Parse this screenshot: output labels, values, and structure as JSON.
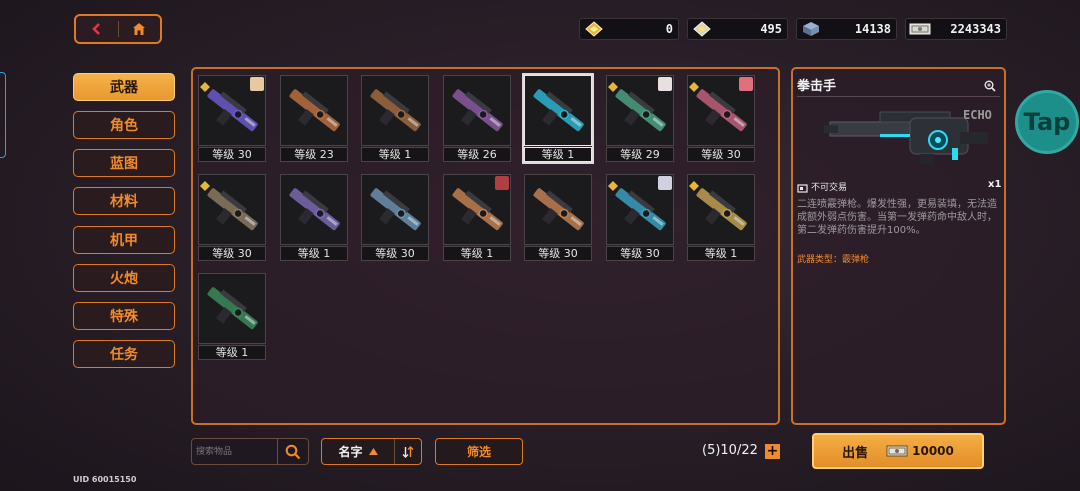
{
  "nav": {
    "back_icon": "back-arrow-icon",
    "home_icon": "home-icon"
  },
  "currencies": [
    {
      "icon": "gold-chip-icon",
      "value": "0"
    },
    {
      "icon": "silver-chip-icon",
      "value": "495"
    },
    {
      "icon": "cube-icon",
      "value": "14138"
    },
    {
      "icon": "cash-icon",
      "value": "2243343"
    }
  ],
  "categories": [
    "武器",
    "角色",
    "蓝图",
    "材料",
    "机甲",
    "火炮",
    "特殊",
    "任务"
  ],
  "items": [
    {
      "level": "等级 30",
      "color": "#6a5ac8"
    },
    {
      "level": "等级 23",
      "color": "#b87040"
    },
    {
      "level": "等级 1",
      "color": "#a06a40"
    },
    {
      "level": "等级 26",
      "color": "#8a5aa0"
    },
    {
      "level": "等级 1",
      "color": "#2ab4d0"
    },
    {
      "level": "等级 29",
      "color": "#4aa080"
    },
    {
      "level": "等级 30",
      "color": "#c0607a"
    },
    {
      "level": "等级 30",
      "color": "#8a7a60"
    },
    {
      "level": "等级 1",
      "color": "#7a6ab0"
    },
    {
      "level": "等级 30",
      "color": "#6a90b0"
    },
    {
      "level": "等级 1",
      "color": "#c08050"
    },
    {
      "level": "等级 30",
      "color": "#c08050"
    },
    {
      "level": "等级 30",
      "color": "#3aa0c0"
    },
    {
      "level": "等级 1",
      "color": "#c0a050"
    },
    {
      "level": "等级 1",
      "color": "#3a8a5a"
    }
  ],
  "detail": {
    "title": "拳击手",
    "brand": "ECHO",
    "tradable": "不可交易",
    "quantity": "x1",
    "description": "二连喷霰弹枪。爆发性强，更易装填，无法造成额外弱点伤害。当第一发弹药命中敌人时，第二发弹药伤害提升100%。",
    "weapon_type": "武器类型：霰弹枪"
  },
  "search": {
    "placeholder": "搜索物品"
  },
  "sort": {
    "label": "名字"
  },
  "filter": {
    "label": "筛选"
  },
  "capacity": {
    "text": "(5)10/22"
  },
  "sell": {
    "label": "出售",
    "price": "10000"
  },
  "uid": "UID 60015150",
  "tap_label": "Tap",
  "accent": "#e07a22"
}
